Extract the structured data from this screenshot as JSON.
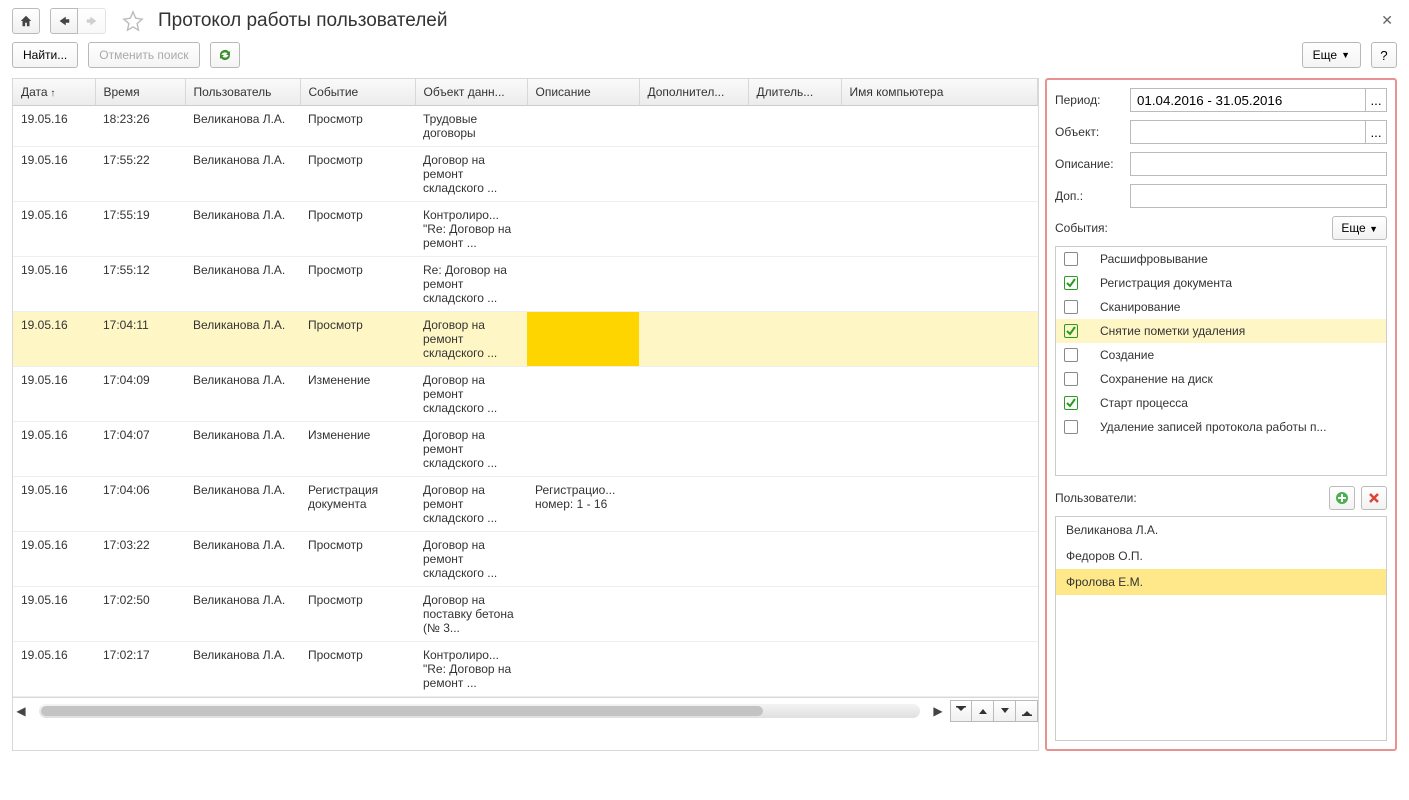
{
  "title": "Протокол работы пользователей",
  "toolbar": {
    "find": "Найти...",
    "cancel": "Отменить поиск",
    "more": "Еще",
    "help": "?"
  },
  "columns": [
    "Дата",
    "Время",
    "Пользователь",
    "Событие",
    "Объект данн...",
    "Описание",
    "Дополнител...",
    "Длитель...",
    "Имя компьютера"
  ],
  "rows": [
    {
      "d": "19.05.16",
      "t": "18:23:26",
      "u": "Великанова Л.А.",
      "e": "Просмотр",
      "o": "Трудовые договоры",
      "desc": "",
      "extra": "",
      "dur": "",
      "host": ""
    },
    {
      "d": "19.05.16",
      "t": "17:55:22",
      "u": "Великанова Л.А.",
      "e": "Просмотр",
      "o": "Договор на ремонт складского ...",
      "desc": "",
      "extra": "",
      "dur": "",
      "host": ""
    },
    {
      "d": "19.05.16",
      "t": "17:55:19",
      "u": "Великанова Л.А.",
      "e": "Просмотр",
      "o": "Контролиро... \"Re: Договор на ремонт ...",
      "desc": "",
      "extra": "",
      "dur": "",
      "host": ""
    },
    {
      "d": "19.05.16",
      "t": "17:55:12",
      "u": "Великанова Л.А.",
      "e": "Просмотр",
      "o": "Re: Договор на ремонт складского ...",
      "desc": "",
      "extra": "",
      "dur": "",
      "host": ""
    },
    {
      "d": "19.05.16",
      "t": "17:04:11",
      "u": "Великанова Л.А.",
      "e": "Просмотр",
      "o": "Договор на ремонт складского ...",
      "desc": "",
      "extra": "",
      "dur": "",
      "host": "",
      "hl": true
    },
    {
      "d": "19.05.16",
      "t": "17:04:09",
      "u": "Великанова Л.А.",
      "e": "Изменение",
      "o": "Договор на ремонт складского ...",
      "desc": "",
      "extra": "",
      "dur": "",
      "host": ""
    },
    {
      "d": "19.05.16",
      "t": "17:04:07",
      "u": "Великанова Л.А.",
      "e": "Изменение",
      "o": "Договор на ремонт складского ...",
      "desc": "",
      "extra": "",
      "dur": "",
      "host": ""
    },
    {
      "d": "19.05.16",
      "t": "17:04:06",
      "u": "Великанова Л.А.",
      "e": "Регистрация документа",
      "o": "Договор на ремонт складского ...",
      "desc": "Регистрацио... номер: 1 - 16",
      "extra": "",
      "dur": "",
      "host": ""
    },
    {
      "d": "19.05.16",
      "t": "17:03:22",
      "u": "Великанова Л.А.",
      "e": "Просмотр",
      "o": "Договор на ремонт складского ...",
      "desc": "",
      "extra": "",
      "dur": "",
      "host": ""
    },
    {
      "d": "19.05.16",
      "t": "17:02:50",
      "u": "Великанова Л.А.",
      "e": "Просмотр",
      "o": "Договор на поставку бетона (№ 3...",
      "desc": "",
      "extra": "",
      "dur": "",
      "host": ""
    },
    {
      "d": "19.05.16",
      "t": "17:02:17",
      "u": "Великанова Л.А.",
      "e": "Просмотр",
      "o": "Контролиро... \"Re: Договор на ремонт ...",
      "desc": "",
      "extra": "",
      "dur": "",
      "host": ""
    }
  ],
  "filter": {
    "period_label": "Период:",
    "period_value": "01.04.2016 - 31.05.2016",
    "object_label": "Объект:",
    "object_value": "",
    "desc_label": "Описание:",
    "desc_value": "",
    "extra_label": "Доп.:",
    "extra_value": "",
    "events_label": "События:",
    "more": "Еще",
    "events": [
      {
        "label": "Расшифровывание",
        "checked": false
      },
      {
        "label": "Регистрация документа",
        "checked": true
      },
      {
        "label": "Сканирование",
        "checked": false
      },
      {
        "label": "Снятие пометки удаления",
        "checked": true,
        "selected": true
      },
      {
        "label": "Создание",
        "checked": false
      },
      {
        "label": "Сохранение на диск",
        "checked": false
      },
      {
        "label": "Старт процесса",
        "checked": true
      },
      {
        "label": "Удаление записей протокола работы п...",
        "checked": false
      }
    ],
    "users_label": "Пользователи:",
    "users": [
      {
        "name": "Великанова Л.А."
      },
      {
        "name": "Федоров О.П."
      },
      {
        "name": "Фролова Е.М.",
        "selected": true
      }
    ]
  }
}
